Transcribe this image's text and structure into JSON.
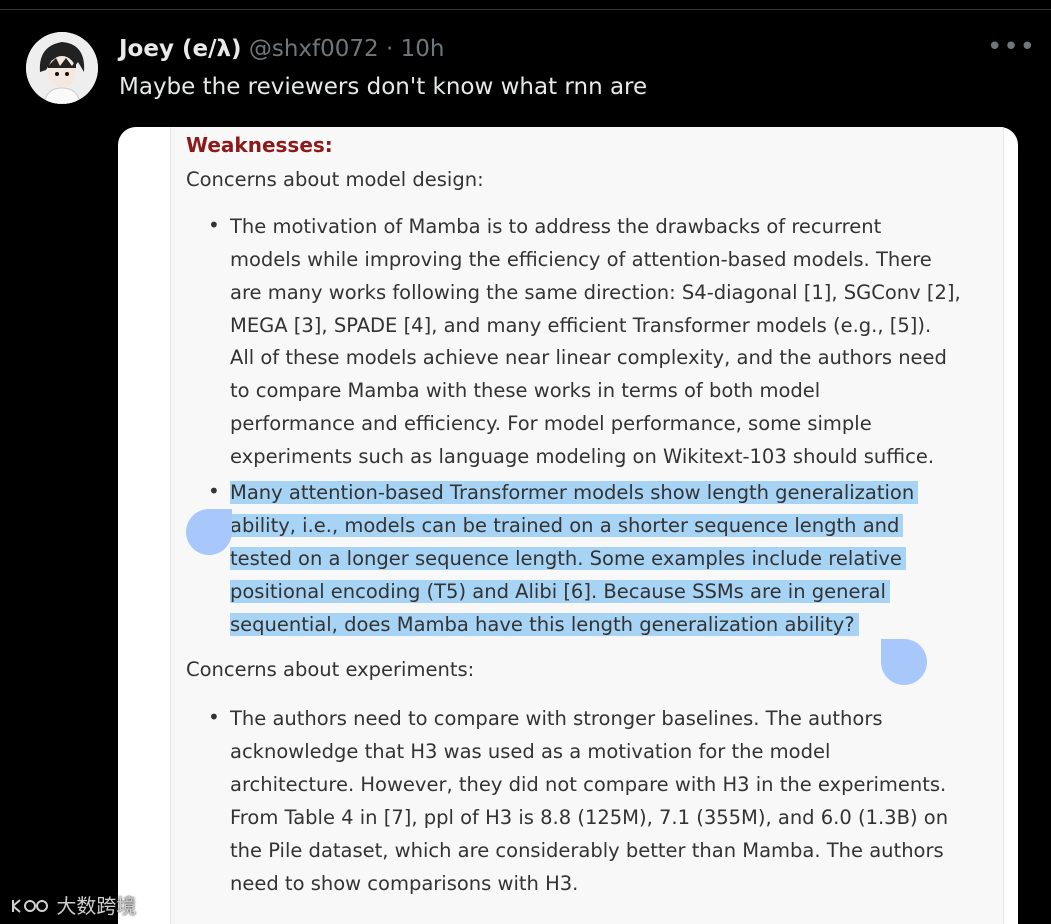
{
  "tweet": {
    "author_name": "Joey (e/λ)",
    "handle": "@shxf0072",
    "separator": " · ",
    "time": "10h",
    "more": "•••",
    "text": "Maybe the reviewers don't know what rnn are"
  },
  "review": {
    "heading": "Weaknesses:",
    "section1": "Concerns about model design:",
    "bullet1": [
      "The motivation of Mamba is to address the drawbacks of recurrent",
      "models while improving the efficiency of attention-based models. There",
      "are many works following the same direction: S4-diagonal [1], SGConv [2],",
      "MEGA [3], SPADE [4], and many efficient Transformer models (e.g., [5]).",
      "All of these models achieve near linear complexity, and the authors need",
      "to compare Mamba with these works in terms of both model",
      "performance and efficiency. For model performance, some simple",
      "experiments such as language modeling on Wikitext-103 should suffice."
    ],
    "bullet2": [
      "Many attention-based Transformer models show length generalization",
      "ability, i.e., models can be trained on a shorter sequence length and",
      "tested on a longer sequence length. Some examples include relative",
      "positional encoding (T5) and Alibi [6]. Because SSMs are in general",
      "sequential, does Mamba have this length generalization ability?"
    ],
    "section2": "Concerns about experiments:",
    "bullet3": [
      "The authors need to compare with stronger baselines. The authors",
      "acknowledge that H3 was used as a motivation for the model",
      "architecture. However, they did not compare with H3 in the experiments.",
      "From Table 4 in [7], ppl of H3 is 8.8 (125M), 7.1 (355M), and 6.0 (1.3B) on",
      "the Pile dataset, which are considerably better than Mamba. The authors",
      "need to show comparisons with H3."
    ]
  },
  "watermark": "大数跨境",
  "colors": {
    "highlight": "#a7d3f4",
    "heading": "#8b1a1a",
    "selection_handle": "#a8c7fa"
  }
}
